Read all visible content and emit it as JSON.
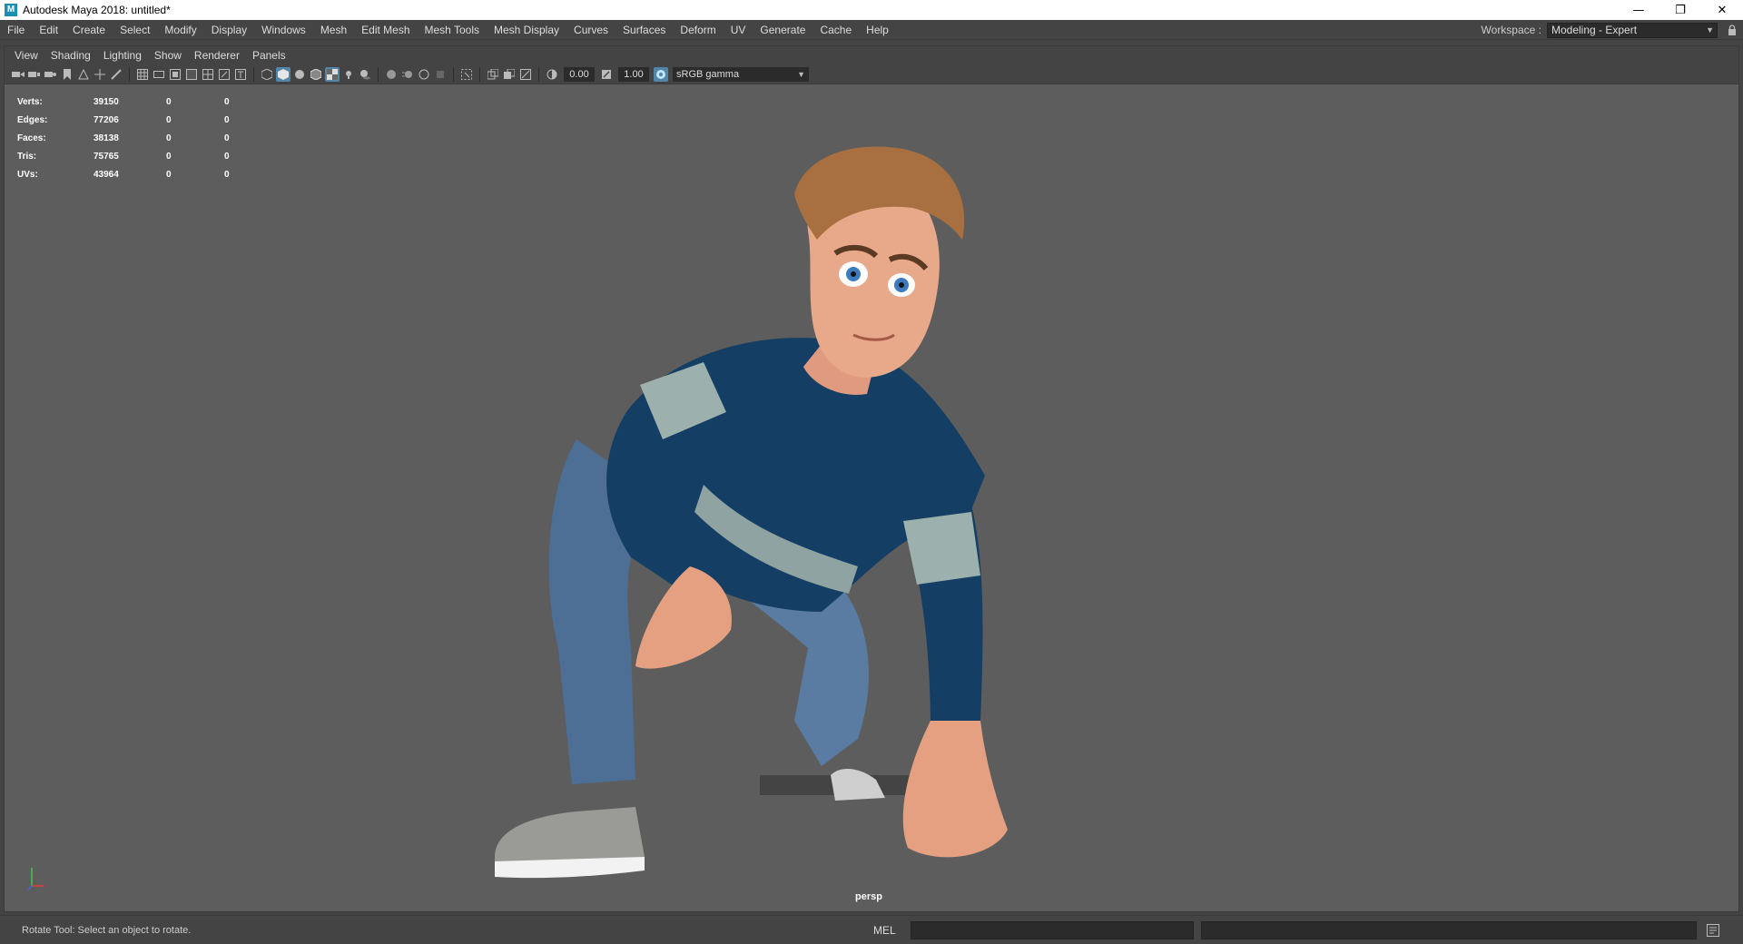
{
  "window": {
    "title": "Autodesk Maya 2018: untitled*",
    "app_icon_letter": "M",
    "minimize": "—",
    "restore": "❐",
    "close": "✕"
  },
  "main_menu": [
    "File",
    "Edit",
    "Create",
    "Select",
    "Modify",
    "Display",
    "Windows",
    "Mesh",
    "Edit Mesh",
    "Mesh Tools",
    "Mesh Display",
    "Curves",
    "Surfaces",
    "Deform",
    "UV",
    "Generate",
    "Cache",
    "Help"
  ],
  "workspace": {
    "label": "Workspace :",
    "value": "Modeling - Expert"
  },
  "panel_menu": [
    "View",
    "Shading",
    "Lighting",
    "Show",
    "Renderer",
    "Panels"
  ],
  "toolbar": {
    "exposure": "0.00",
    "gamma": "1.00",
    "color_space": "sRGB gamma"
  },
  "hud": {
    "rows": [
      {
        "label": "Verts:",
        "v1": "39150",
        "v2": "0",
        "v3": "0"
      },
      {
        "label": "Edges:",
        "v1": "77206",
        "v2": "0",
        "v3": "0"
      },
      {
        "label": "Faces:",
        "v1": "38138",
        "v2": "0",
        "v3": "0"
      },
      {
        "label": "Tris:",
        "v1": "75765",
        "v2": "0",
        "v3": "0"
      },
      {
        "label": "UVs:",
        "v1": "43964",
        "v2": "0",
        "v3": "0"
      }
    ]
  },
  "viewport": {
    "camera": "persp"
  },
  "status": {
    "help_text": "Rotate Tool: Select an object to rotate.",
    "mel_label": "MEL"
  },
  "colors": {
    "accent": "#5285a6",
    "viewport_bg": "#5d5d5d",
    "ui_bg": "#444444"
  }
}
